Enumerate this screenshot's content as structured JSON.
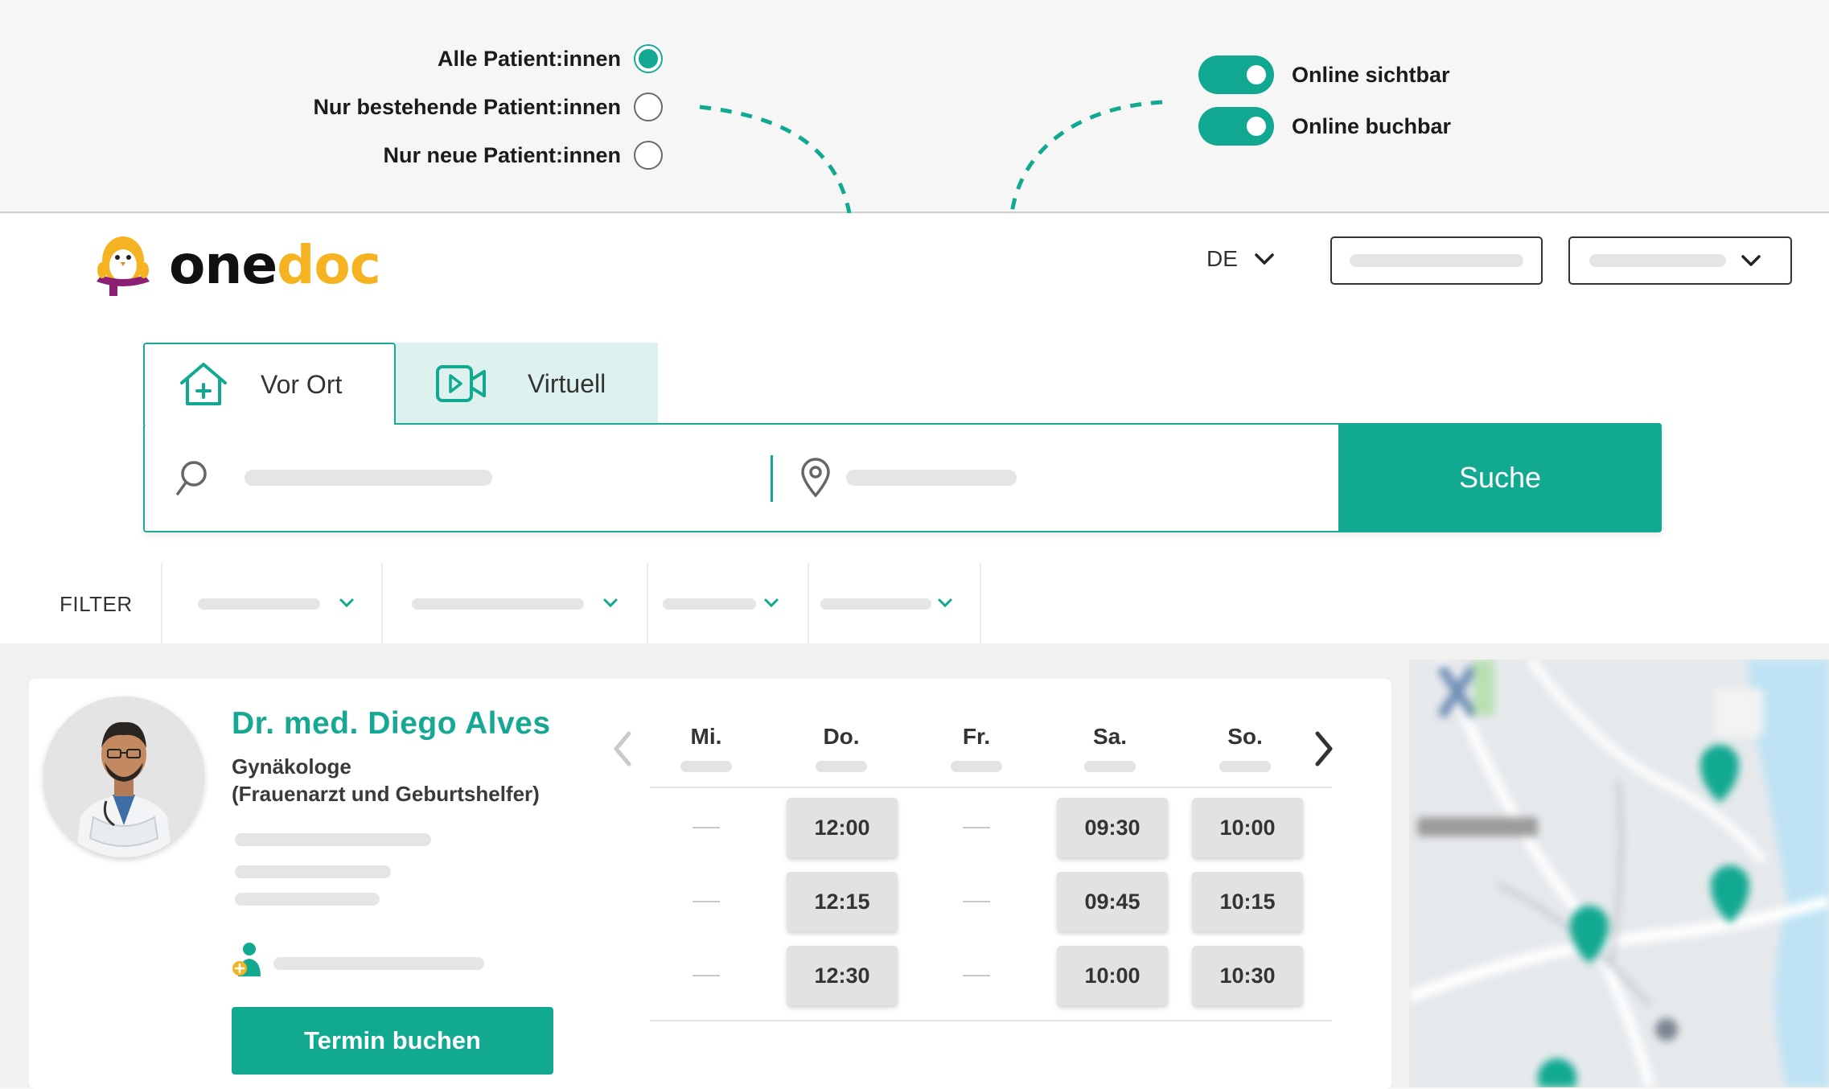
{
  "patient_options": [
    {
      "label": "Alle Patient:innen",
      "selected": true
    },
    {
      "label": "Nur bestehende Patient:innen",
      "selected": false
    },
    {
      "label": "Nur neue Patient:innen",
      "selected": false
    }
  ],
  "visibility_toggles": [
    {
      "label": "Online sichtbar",
      "on": true
    },
    {
      "label": "Online buchbar",
      "on": true
    }
  ],
  "header": {
    "logo_one": "one",
    "logo_doc": "doc",
    "language": "DE"
  },
  "tabs": [
    {
      "label": "Vor Ort",
      "icon": "house-plus-icon",
      "active": true
    },
    {
      "label": "Virtuell",
      "icon": "video-camera-icon",
      "active": false
    }
  ],
  "search": {
    "button_label": "Suche",
    "query_icon": "search-icon",
    "location_icon": "location-pin-icon"
  },
  "filters": {
    "label": "FILTER"
  },
  "doctor": {
    "name": "Dr. med. Diego Alves",
    "specialty_line1": "Gynäkologe",
    "specialty_line2": "(Frauenarzt und Geburtshelfer)",
    "book_button": "Termin buchen"
  },
  "schedule": {
    "days": [
      "Mi.",
      "Do.",
      "Fr.",
      "Sa.",
      "So."
    ],
    "slots": {
      "Mi.": [],
      "Do.": [
        "12:00",
        "12:15",
        "12:30"
      ],
      "Fr.": [],
      "Sa.": [
        "09:30",
        "09:45",
        "10:00"
      ],
      "So.": [
        "10:00",
        "10:15",
        "10:30"
      ]
    }
  },
  "colors": {
    "accent": "#12a991",
    "accent_light": "#ddf2ef",
    "logo_yellow": "#f6b321"
  }
}
